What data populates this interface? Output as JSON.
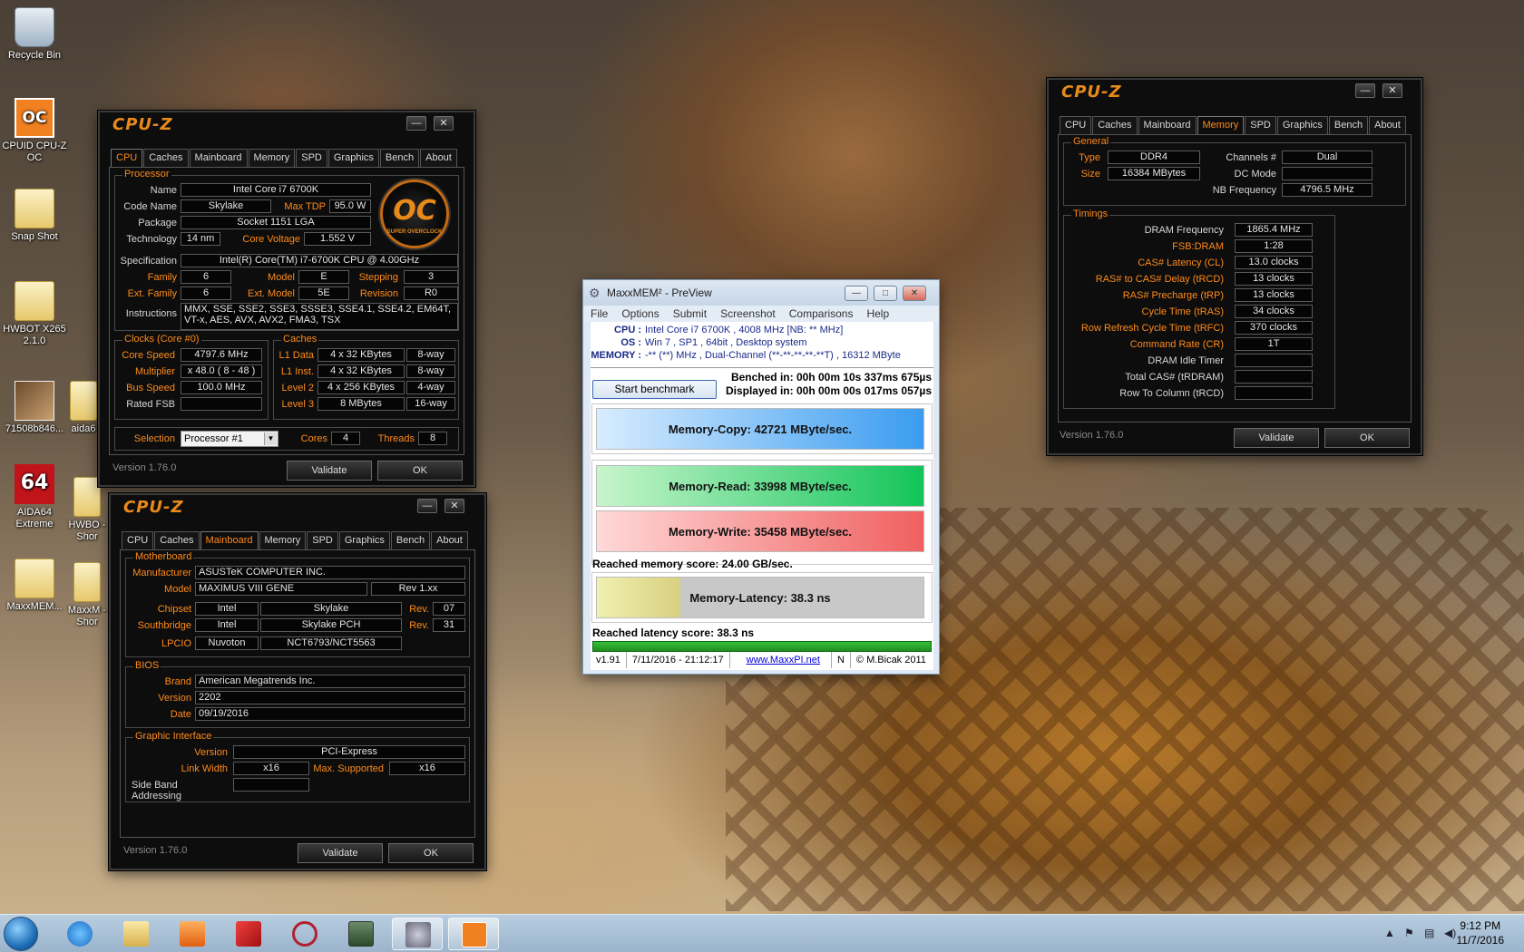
{
  "desktop": {
    "icons": [
      {
        "label": "Recycle Bin",
        "icon": "recycle-bin-icon"
      },
      {
        "label": "CPUID CPU-Z OC",
        "icon": "cpuz-oc-icon"
      },
      {
        "label": "Snap Shot",
        "icon": "folder-icon"
      },
      {
        "label": "HWBOT X265 2.1.0",
        "icon": "folder-icon"
      },
      {
        "label": "71508b846...",
        "icon": "image-icon"
      },
      {
        "label": "aida6",
        "icon": "app-icon"
      },
      {
        "label": "AIDA64 Extreme",
        "icon": "aida64-icon"
      },
      {
        "label": "HWBO - Shor",
        "icon": "shortcut-icon"
      },
      {
        "label": "MaxxMEM...",
        "icon": "folder-icon"
      },
      {
        "label": "MaxxM - Shor",
        "icon": "shortcut-icon"
      }
    ]
  },
  "cpuz_cpu": {
    "title": "CPU-Z",
    "tabs": [
      "CPU",
      "Caches",
      "Mainboard",
      "Memory",
      "SPD",
      "Graphics",
      "Bench",
      "About"
    ],
    "active_tab": "CPU",
    "processor_title": "Processor",
    "name_label": "Name",
    "name": "Intel Core i7 6700K",
    "codename_label": "Code Name",
    "codename": "Skylake",
    "maxtdp_label": "Max TDP",
    "maxtdp": "95.0 W",
    "package_label": "Package",
    "package": "Socket 1151 LGA",
    "technology_label": "Technology",
    "technology": "14 nm",
    "corevoltage_label": "Core Voltage",
    "corevoltage": "1.552 V",
    "spec_label": "Specification",
    "spec": "Intel(R) Core(TM) i7-6700K CPU @ 4.00GHz",
    "family_label": "Family",
    "family": "6",
    "model_label": "Model",
    "model": "E",
    "stepping_label": "Stepping",
    "stepping": "3",
    "extfamily_label": "Ext. Family",
    "extfamily": "6",
    "extmodel_label": "Ext. Model",
    "extmodel": "5E",
    "revision_label": "Revision",
    "revision": "R0",
    "instructions_label": "Instructions",
    "instructions": "MMX, SSE, SSE2, SSE3, SSSE3, SSE4.1, SSE4.2, EM64T, VT-x, AES, AVX, AVX2, FMA3, TSX",
    "clocks_title": "Clocks (Core #0)",
    "corespeed_label": "Core Speed",
    "corespeed": "4797.6 MHz",
    "multiplier_label": "Multiplier",
    "multiplier": "x 48.0 ( 8 - 48 )",
    "busspeed_label": "Bus Speed",
    "busspeed": "100.0 MHz",
    "ratedfsb_label": "Rated FSB",
    "ratedfsb": "",
    "caches_title": "Caches",
    "l1d_label": "L1 Data",
    "l1d": "4 x 32 KBytes",
    "l1d_way": "8-way",
    "l1i_label": "L1 Inst.",
    "l1i": "4 x 32 KBytes",
    "l1i_way": "8-way",
    "l2_label": "Level 2",
    "l2": "4 x 256 KBytes",
    "l2_way": "4-way",
    "l3_label": "Level 3",
    "l3": "8 MBytes",
    "l3_way": "16-way",
    "selection_label": "Selection",
    "selection": "Processor #1",
    "cores_label": "Cores",
    "cores": "4",
    "threads_label": "Threads",
    "threads": "8",
    "version": "Version 1.76.0",
    "validate": "Validate",
    "ok": "OK",
    "badge_text": "OC",
    "badge_sub": "SUPER OVERCLOCK"
  },
  "cpuz_mb": {
    "title": "CPU-Z",
    "tabs": [
      "CPU",
      "Caches",
      "Mainboard",
      "Memory",
      "SPD",
      "Graphics",
      "Bench",
      "About"
    ],
    "active_tab": "Mainboard",
    "motherboard_title": "Motherboard",
    "manufacturer_label": "Manufacturer",
    "manufacturer": "ASUSTeK COMPUTER INC.",
    "model_label": "Model",
    "model": "MAXIMUS VIII GENE",
    "model_rev": "Rev 1.xx",
    "chipset_label": "Chipset",
    "chipset": "Intel",
    "chipset_name": "Skylake",
    "rev_label": "Rev.",
    "chipset_rev": "07",
    "southbridge_label": "Southbridge",
    "southbridge": "Intel",
    "southbridge_name": "Skylake PCH",
    "southbridge_rev": "31",
    "lpcio_label": "LPCIO",
    "lpcio": "Nuvoton",
    "lpcio_name": "NCT6793/NCT5563",
    "bios_title": "BIOS",
    "brand_label": "Brand",
    "brand": "American Megatrends Inc.",
    "version_label": "Version",
    "bios_version": "2202",
    "date_label": "Date",
    "date": "09/19/2016",
    "gfx_title": "Graphic Interface",
    "gfx_version_label": "Version",
    "gfx_version": "PCI-Express",
    "linkwidth_label": "Link Width",
    "linkwidth": "x16",
    "maxsupported_label": "Max. Supported",
    "maxsupported": "x16",
    "sideband_label": "Side Band Addressing",
    "sideband": "",
    "version": "Version 1.76.0",
    "validate": "Validate",
    "ok": "OK"
  },
  "cpuz_mem": {
    "title": "CPU-Z",
    "tabs": [
      "CPU",
      "Caches",
      "Mainboard",
      "Memory",
      "SPD",
      "Graphics",
      "Bench",
      "About"
    ],
    "active_tab": "Memory",
    "general_title": "General",
    "type_label": "Type",
    "type": "DDR4",
    "channels_label": "Channels #",
    "channels": "Dual",
    "size_label": "Size",
    "size": "16384 MBytes",
    "dcmode_label": "DC Mode",
    "dcmode": "",
    "nbfreq_label": "NB Frequency",
    "nbfreq": "4796.5 MHz",
    "timings_title": "Timings",
    "timings": [
      {
        "label": "DRAM Frequency",
        "value": "1865.4 MHz",
        "color": "white"
      },
      {
        "label": "FSB:DRAM",
        "value": "1:28",
        "color": "orange"
      },
      {
        "label": "CAS# Latency (CL)",
        "value": "13.0 clocks",
        "color": "orange"
      },
      {
        "label": "RAS# to CAS# Delay (tRCD)",
        "value": "13 clocks",
        "color": "orange"
      },
      {
        "label": "RAS# Precharge (tRP)",
        "value": "13 clocks",
        "color": "orange"
      },
      {
        "label": "Cycle Time (tRAS)",
        "value": "34 clocks",
        "color": "orange"
      },
      {
        "label": "Row Refresh Cycle Time (tRFC)",
        "value": "370 clocks",
        "color": "orange"
      },
      {
        "label": "Command Rate (CR)",
        "value": "1T",
        "color": "orange"
      },
      {
        "label": "DRAM Idle Timer",
        "value": "",
        "color": "white"
      },
      {
        "label": "Total CAS# (tRDRAM)",
        "value": "",
        "color": "white"
      },
      {
        "label": "Row To Column (tRCD)",
        "value": "",
        "color": "white"
      }
    ],
    "version": "Version 1.76.0",
    "validate": "Validate",
    "ok": "OK"
  },
  "maxxmem": {
    "title": "MaxxMEM² - PreView",
    "menu": [
      "File",
      "Options",
      "Submit",
      "Screenshot",
      "Comparisons",
      "Help"
    ],
    "cpu_label": "CPU :",
    "cpu": "Intel Core i7 6700K , 4008 MHz  [NB: ** MHz]",
    "os_label": "OS :",
    "os": "Win 7 , SP1 , 64bit , Desktop system",
    "memory_label": "MEMORY :",
    "memory": "-** (**) MHz , Dual-Channel (**-**-**-**-**T) , 16312 MByte",
    "start_button": "Start benchmark",
    "benched": "Benched in: 00h 00m 10s 337ms 675µs",
    "displayed": "Displayed in: 00h 00m 00s 017ms 057µs",
    "copy": "Memory-Copy: 42721 MByte/sec.",
    "read": "Memory-Read: 33998 MByte/sec.",
    "write": "Memory-Write: 35458 MByte/sec.",
    "memory_score": "Reached memory score: 24.00 GB/sec.",
    "latency": "Memory-Latency: 38.3 ns",
    "latency_score": "Reached latency score: 38.3 ns",
    "progress": 1.0,
    "status_version": "v1.91",
    "status_date": "7/11/2016 - 21:12:17",
    "status_link": "www.MaxxPI.net",
    "status_n": "N",
    "status_copyright": "© M.Bicak 2011"
  },
  "taskbar": {
    "items": [
      "start-orb",
      "internet-explorer",
      "file-explorer",
      "media-player",
      "app-red",
      "app-network",
      "screenshot-app",
      "maxxmem-app",
      "cpuz-app"
    ],
    "time": "9:12 PM",
    "date": "11/7/2016"
  }
}
